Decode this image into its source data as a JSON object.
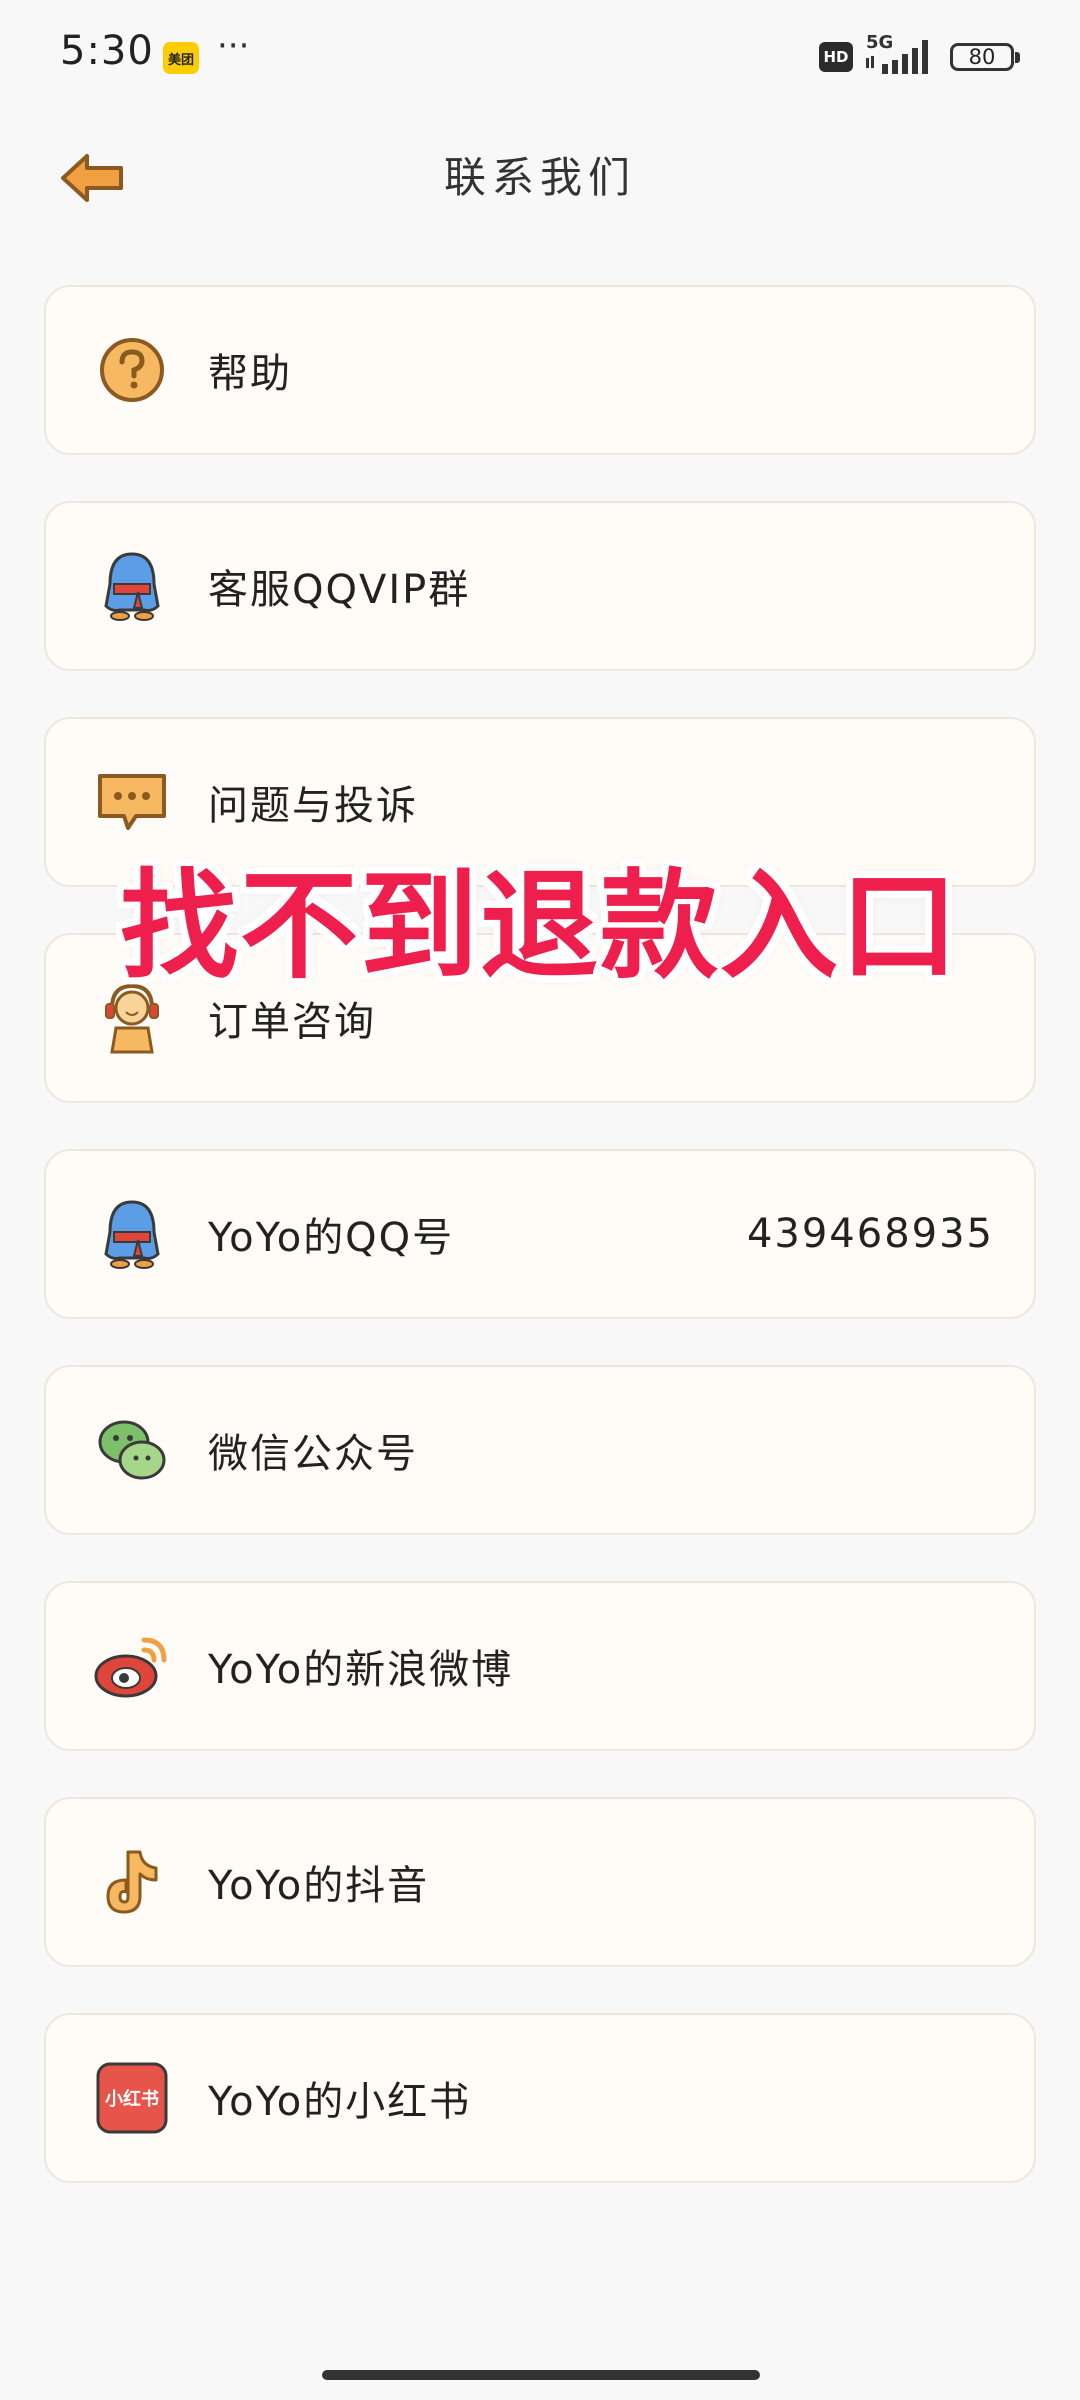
{
  "status_bar": {
    "time": "5:30",
    "app_badge": "美团",
    "more": "···",
    "hd": "HD",
    "network": "5G",
    "battery": "80"
  },
  "header": {
    "title": "联系我们",
    "back_icon": "back-arrow-icon"
  },
  "items": [
    {
      "label": "帮助",
      "value": "",
      "icon": "help-icon"
    },
    {
      "label": "客服QQVIP群",
      "value": "",
      "icon": "qq-penguin-icon"
    },
    {
      "label": "问题与投诉",
      "value": "",
      "icon": "chat-bubble-icon"
    },
    {
      "label": "订单咨询",
      "value": "",
      "icon": "customer-service-icon"
    },
    {
      "label": "YoYo的QQ号",
      "value": "439468935",
      "icon": "qq-penguin-icon"
    },
    {
      "label": "微信公众号",
      "value": "",
      "icon": "wechat-icon"
    },
    {
      "label": "YoYo的新浪微博",
      "value": "",
      "icon": "weibo-icon"
    },
    {
      "label": "YoYo的抖音",
      "value": "",
      "icon": "douyin-icon"
    },
    {
      "label": "YoYo的小红书",
      "value": "",
      "icon": "xiaohongshu-icon",
      "icon_text": "小红书"
    }
  ],
  "overlay_caption": "找不到退款入口",
  "colors": {
    "accent": "#f0a040",
    "overlay": "#ee1f4c",
    "card_bg": "#fffcf7",
    "qq_blue": "#5b9ee6",
    "wechat_green": "#7cc06a",
    "weibo_red": "#e0453a",
    "xhs_red": "#e6544a"
  }
}
